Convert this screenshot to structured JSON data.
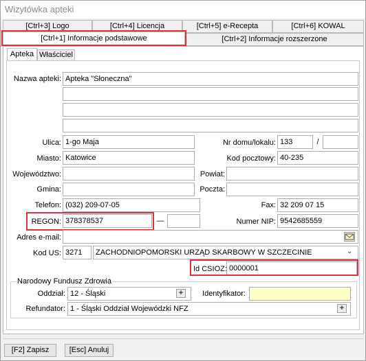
{
  "window": {
    "title": "Wizytówka apteki"
  },
  "top_tabs": {
    "logo": "[Ctrl+3] Logo",
    "licencja": "[Ctrl+4] Licencja",
    "erecepta": "[Ctrl+5] e-Recepta",
    "kowal": "[Ctrl+6] KOWAL",
    "podstawowe": "[Ctrl+1] Informacje podstawowe",
    "rozszerzone": "[Ctrl+2] Informacje rozszerzone"
  },
  "sub_tabs": {
    "apteka": "Apteka",
    "wlasciciel": "Właściciel"
  },
  "form": {
    "nazwa_label": "Nazwa apteki:",
    "nazwa_value": "Apteka \"Słoneczna\"",
    "ulica_label": "Ulica:",
    "ulica_value": "1-go Maja",
    "nr_label": "Nr domu/lokalu:",
    "nr_value": "133",
    "nr_sep": "/",
    "miasto_label": "Miasto:",
    "miasto_value": "Katowice",
    "kod_label": "Kod pocztowy:",
    "kod_value": "40-235",
    "woj_label": "Województwo:",
    "powiat_label": "Powiat:",
    "gmina_label": "Gmina:",
    "poczta_label": "Poczta:",
    "telefon_label": "Telefon:",
    "telefon_value": "(032) 209-07-05",
    "fax_label": "Fax:",
    "fax_value": "32 209 07 15",
    "regon_label": "REGON:",
    "regon_value": "378378537",
    "regon_dash": "—",
    "nip_label": "Numer NIP:",
    "nip_value": "9542685559",
    "email_label": "Adres e-mail:",
    "kodus_label": "Kod US:",
    "kodus_code": "3271",
    "kodus_name": "ZACHODNIOPOMORSKI URZĄD SKARBOWY W SZCZECINIE",
    "csioz_label": "Id CSIOZ:",
    "csioz_value": "0000001"
  },
  "nfz": {
    "group_title": "Narodowy Fundusz Zdrowia",
    "oddzial_label": "Oddział:",
    "oddzial_value": "12 - Śląski",
    "ident_label": "Identyfikator:",
    "refundator_label": "Refundator:",
    "refundator_value": "1 - Śląski Oddział Wojewódzki NFZ"
  },
  "footer": {
    "save": "[F2] Zapisz",
    "cancel": "[Esc] Anuluj"
  },
  "colors": {
    "highlight": "#e0303a",
    "field_required": "#ffffc8"
  }
}
